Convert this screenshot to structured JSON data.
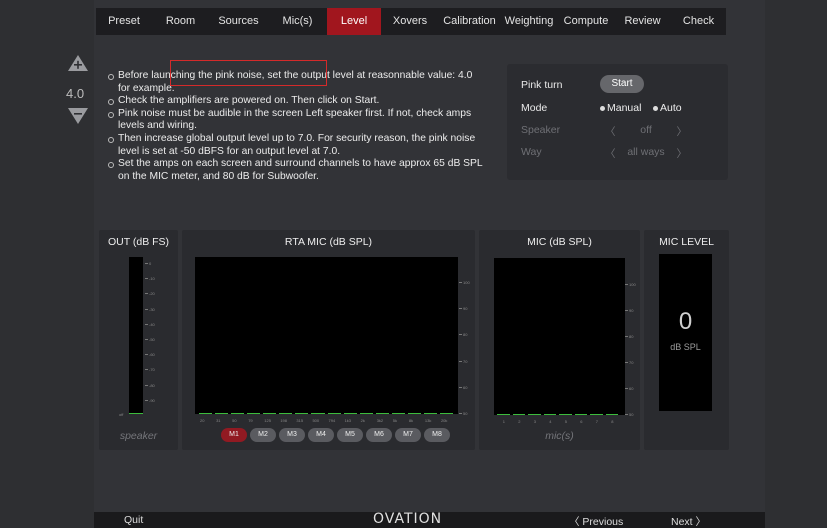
{
  "nav": {
    "tabs": [
      {
        "label": "Preset"
      },
      {
        "label": "Room"
      },
      {
        "label": "Sources"
      },
      {
        "label": "Mic(s)"
      },
      {
        "label": "Level"
      },
      {
        "label": "Xovers"
      },
      {
        "label": "Calibration"
      },
      {
        "label": "Weighting"
      },
      {
        "label": "Compute"
      },
      {
        "label": "Review"
      },
      {
        "label": "Check"
      }
    ],
    "active_tab": "Level"
  },
  "volume": {
    "value": "4.0",
    "up_icon": "plus-triangle-icon",
    "down_icon": "minus-triangle-icon"
  },
  "instructions": [
    "Before launching the pink noise, set the output level at reasonnable value: 4.0 for example.",
    "Check the amplifiers are powered on. Then click on Start.",
    "Pink noise must be audible in the screen Left speaker first. If not, check amps levels and wiring.",
    "Then increase global output level up to 7.0. For security reason, the pink noise level is set at -50 dBFS for an output level at 7.0.",
    "Set the amps on each screen and surround channels to have approx 65 dB SPL on the MIC meter, and 80 dB for Subwoofer."
  ],
  "pink_panel": {
    "pink_turn_label": "Pink turn",
    "start_label": "Start",
    "mode_label": "Mode",
    "mode_manual": "Manual",
    "mode_auto": "Auto",
    "speaker_label": "Speaker",
    "speaker_value": "off",
    "way_label": "Way",
    "way_value": "all ways",
    "prev_arrow": "〈",
    "next_arrow": "〉"
  },
  "out_meter": {
    "title": "OUT (dB FS)",
    "footer": "speaker",
    "ticks": [
      "0",
      "-10",
      "-20",
      "-30",
      "-40",
      "-50",
      "-60",
      "-70",
      "-80",
      "-90"
    ],
    "bottom_label": "off"
  },
  "rta": {
    "title": "RTA MIC (dB SPL)",
    "freq_labels": [
      "20",
      "31",
      "50",
      "79",
      "125",
      "198",
      "315",
      "500",
      "794",
      "1k3",
      "2k",
      "3k2",
      "5k",
      "8k",
      "13k",
      "20k"
    ],
    "ticks": [
      "100",
      "90",
      "80",
      "70",
      "60",
      "50"
    ],
    "mic_buttons": [
      "M1",
      "M2",
      "M3",
      "M4",
      "M5",
      "M6",
      "M7",
      "M8"
    ],
    "active_mic": "M1"
  },
  "mic_meter": {
    "title": "MIC (dB SPL)",
    "footer": "mic(s)",
    "channels": [
      "1",
      "2",
      "3",
      "4",
      "5",
      "6",
      "7",
      "8"
    ],
    "ticks": [
      "100",
      "90",
      "80",
      "70",
      "60",
      "50"
    ]
  },
  "mic_level": {
    "title": "MIC LEVEL",
    "value": "0",
    "unit": "dB SPL"
  },
  "bottom": {
    "quit": "Quit",
    "logo": "OVATION",
    "previous": "〈 Previous",
    "next": "Next 〉"
  },
  "colors": {
    "accent": "#a1161e",
    "meter_green": "#3cbc3c",
    "highlight_red": "#d42a2a"
  }
}
